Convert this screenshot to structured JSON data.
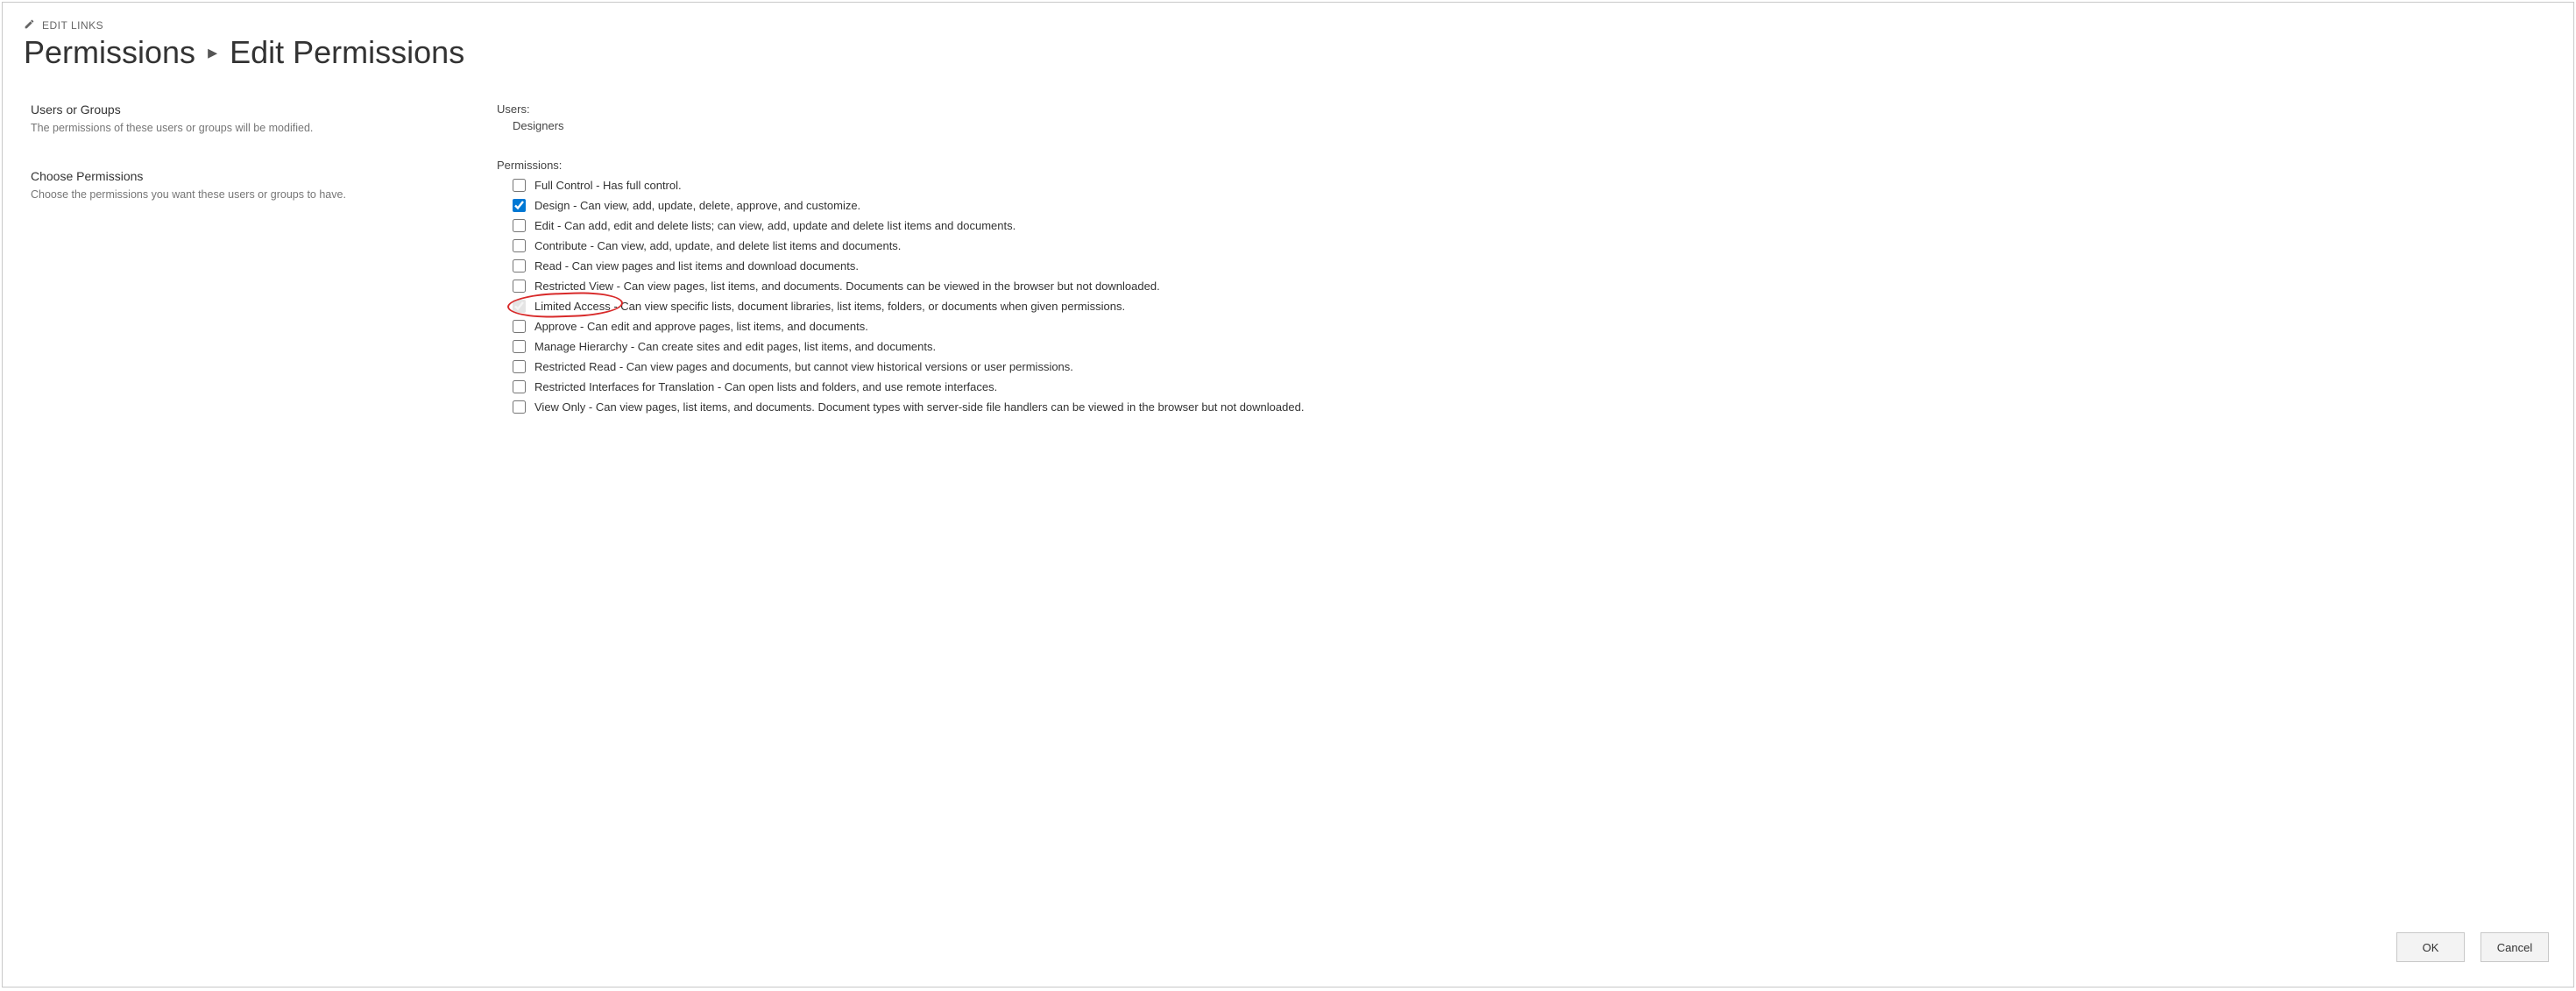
{
  "editLinks": "EDIT LINKS",
  "breadcrumb": {
    "root": "Permissions",
    "current": "Edit Permissions"
  },
  "sections": {
    "usersGroups": {
      "title": "Users or Groups",
      "desc": "The permissions of these users or groups will be modified."
    },
    "choosePerms": {
      "title": "Choose Permissions",
      "desc": "Choose the permissions you want these users or groups to have."
    }
  },
  "usersLabel": "Users:",
  "usersValue": "Designers",
  "permissionsLabel": "Permissions:",
  "permissions": [
    {
      "id": "full-control",
      "checked": false,
      "disabled": false,
      "label": "Full Control - Has full control."
    },
    {
      "id": "design",
      "checked": true,
      "disabled": false,
      "label": "Design - Can view, add, update, delete, approve, and customize."
    },
    {
      "id": "edit",
      "checked": false,
      "disabled": false,
      "label": "Edit - Can add, edit and delete lists; can view, add, update and delete list items and documents."
    },
    {
      "id": "contribute",
      "checked": false,
      "disabled": false,
      "label": "Contribute - Can view, add, update, and delete list items and documents."
    },
    {
      "id": "read",
      "checked": false,
      "disabled": false,
      "label": "Read - Can view pages and list items and download documents."
    },
    {
      "id": "restricted-view",
      "checked": false,
      "disabled": false,
      "label": "Restricted View - Can view pages, list items, and documents. Documents can be viewed in the browser but not downloaded."
    },
    {
      "id": "limited-access",
      "checked": true,
      "disabled": true,
      "label": "Limited Access - Can view specific lists, document libraries, list items, folders, or documents when given permissions.",
      "annotated": true
    },
    {
      "id": "approve",
      "checked": false,
      "disabled": false,
      "label": "Approve - Can edit and approve pages, list items, and documents."
    },
    {
      "id": "manage-hierarchy",
      "checked": false,
      "disabled": false,
      "label": "Manage Hierarchy - Can create sites and edit pages, list items, and documents."
    },
    {
      "id": "restricted-read",
      "checked": false,
      "disabled": false,
      "label": "Restricted Read - Can view pages and documents, but cannot view historical versions or user permissions."
    },
    {
      "id": "restricted-interfaces",
      "checked": false,
      "disabled": false,
      "label": "Restricted Interfaces for Translation - Can open lists and folders, and use remote interfaces."
    },
    {
      "id": "view-only",
      "checked": false,
      "disabled": false,
      "label": "View Only - Can view pages, list items, and documents. Document types with server-side file handlers can be viewed in the browser but not downloaded."
    }
  ],
  "buttons": {
    "ok": "OK",
    "cancel": "Cancel"
  }
}
